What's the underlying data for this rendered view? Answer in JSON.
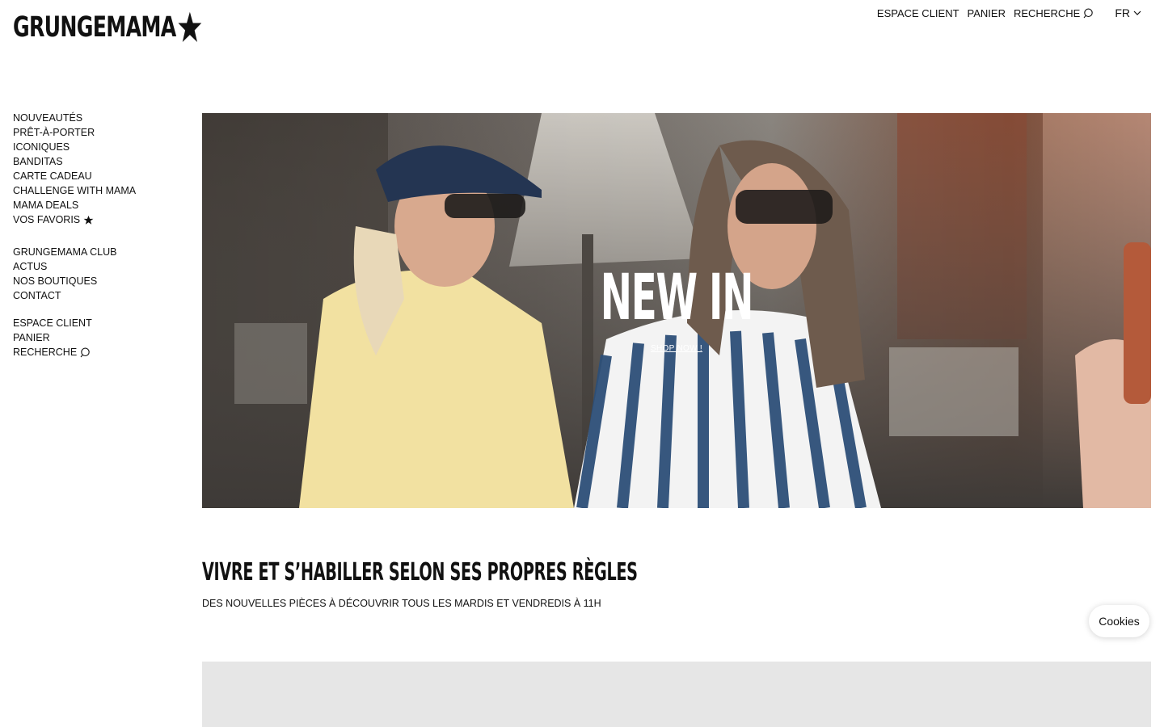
{
  "brand": {
    "logo_text": "GRUNGEMAMA"
  },
  "topnav": {
    "account": "ESPACE CLIENT",
    "cart": "PANIER",
    "search": "RECHERCHE",
    "language": "FR"
  },
  "sidebar": {
    "primary": [
      {
        "label": "NOUVEAUTÉS"
      },
      {
        "label": "PRÊT-À-PORTER"
      },
      {
        "label": "ICONIQUES"
      },
      {
        "label": "BANDITAS"
      },
      {
        "label": "CARTE CADEAU"
      },
      {
        "label": "CHALLENGE WITH MAMA"
      },
      {
        "label": "MAMA DEALS"
      },
      {
        "label": "VOS FAVORIS"
      }
    ],
    "secondary": [
      {
        "label": "GRUNGEMAMA CLUB"
      },
      {
        "label": "ACTUS"
      },
      {
        "label": "NOS BOUTIQUES"
      },
      {
        "label": "CONTACT"
      }
    ],
    "account": [
      {
        "label": "ESPACE CLIENT"
      },
      {
        "label": "PANIER"
      },
      {
        "label": "RECHERCHE"
      }
    ]
  },
  "hero": {
    "title": "NEW IN",
    "cta": "SHOP NOW !"
  },
  "content": {
    "tagline": "VIVRE ET S’HABILLER SELON SES PROPRES RÈGLES",
    "subline": "DES NOUVELLES PIÈCES À DÉCOUVRIR TOUS LES MARDIS ET VENDREDIS À 11H"
  },
  "cookies": {
    "label": "Cookies"
  },
  "icons": {
    "logo": "star-icon",
    "favorites": "star-icon",
    "search": "search-icon",
    "language": "chevron-down-icon"
  }
}
